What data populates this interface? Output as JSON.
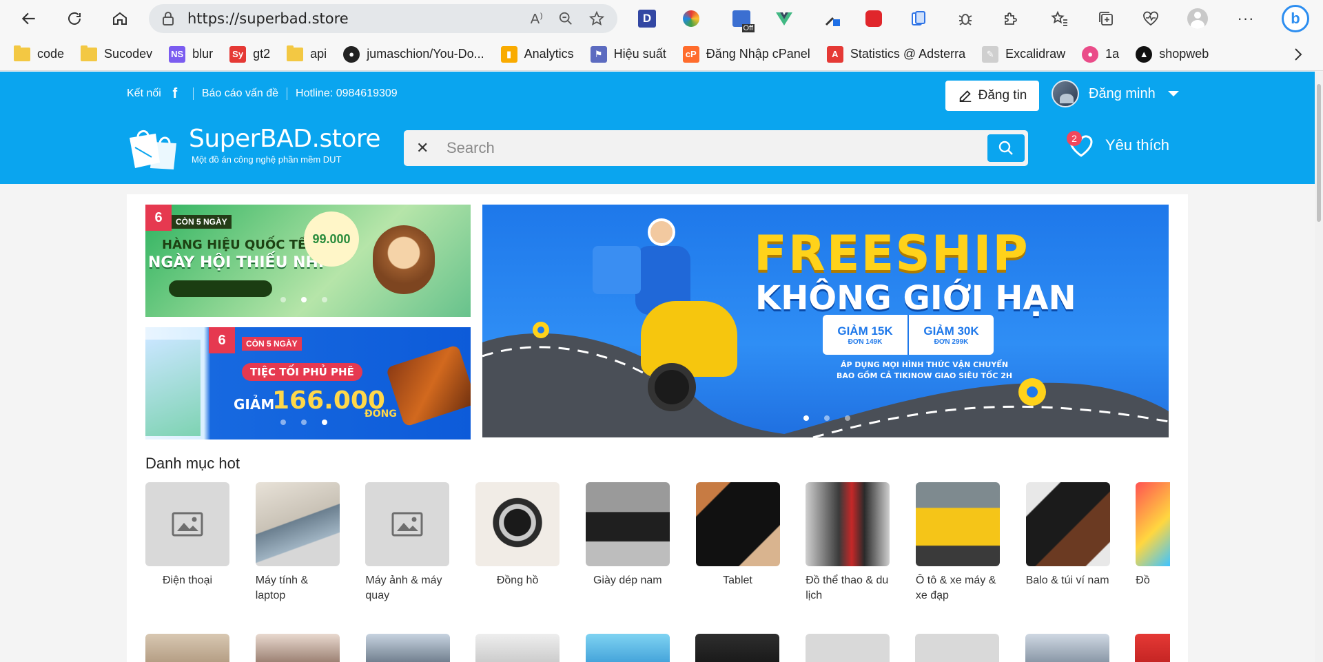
{
  "browser": {
    "url": "https://superbad.store",
    "bookmarks": [
      {
        "label": "code",
        "icon": "folder-icon"
      },
      {
        "label": "Sucodev",
        "icon": "folder-icon"
      },
      {
        "label": "blur",
        "icon": "blur-icon"
      },
      {
        "label": "gt2",
        "icon": "sy-icon"
      },
      {
        "label": "api",
        "icon": "folder-icon"
      },
      {
        "label": "jumaschion/You-Do...",
        "icon": "github-icon"
      },
      {
        "label": "Analytics",
        "icon": "analytics-icon"
      },
      {
        "label": "Hiệu suất",
        "icon": "performance-icon"
      },
      {
        "label": "Đăng Nhập cPanel",
        "icon": "cpanel-icon"
      },
      {
        "label": "Statistics @ Adsterra",
        "icon": "adsterra-icon"
      },
      {
        "label": "Excalidraw",
        "icon": "excalidraw-icon"
      },
      {
        "label": "1a",
        "icon": "dribbble-icon"
      },
      {
        "label": "shopweb",
        "icon": "shopweb-icon"
      }
    ]
  },
  "header": {
    "connect_label": "Kết nối",
    "report_label": "Báo cáo vấn đề",
    "hotline_label": "Hotline: 0984619309",
    "post_button": "Đăng tin",
    "user_name": "Đăng minh",
    "logo_title": "SuperBAD.store",
    "logo_subtitle": "Một đồ án công nghệ phần mềm DUT",
    "search_placeholder": "Search",
    "favorites_label": "Yêu thích",
    "favorites_count": "2"
  },
  "banners": {
    "b1_tag": "CÒN 5 NGÀY",
    "b1_line1": "HÀNG HIỆU QUỐC TẾ",
    "b1_line2": "NGÀY HỘI THIẾU NHI",
    "b1_price": "99.000",
    "b2_tag": "CÒN 5 NGÀY",
    "b2_line1": "TIỆC TỐI PHỦ PHÊ",
    "b2_line2": "GIẢM",
    "b2_price": "166.000",
    "b2_unit": "ĐỒNG",
    "b3_line1": "FREESHIP",
    "b3_line2": "KHÔNG GIỚI HẠN",
    "b3_offer1_big": "GIẢM 15K",
    "b3_offer1_small": "ĐƠN 149K",
    "b3_offer2_big": "GIẢM 30K",
    "b3_offer2_small": "ĐƠN 299K",
    "b3_note1": "ÁP DỤNG MỌI HÌNH THỨC VẬN CHUYỂN",
    "b3_note2": "BAO GỒM CẢ TIKINOW GIAO SIÊU TỐC 2H"
  },
  "categories": {
    "title": "Danh mục hot",
    "items": [
      {
        "label": "Điện thoại",
        "thumb": "placeholder"
      },
      {
        "label": "Máy tính & laptop",
        "thumb": "laptop"
      },
      {
        "label": "Máy ảnh & máy quay",
        "thumb": "placeholder"
      },
      {
        "label": "Đồng hồ",
        "thumb": "watch"
      },
      {
        "label": "Giày dép nam",
        "thumb": "sandals"
      },
      {
        "label": "Tablet",
        "thumb": "tablet"
      },
      {
        "label": "Đồ thể thao & du lịch",
        "thumb": "sports"
      },
      {
        "label": "Ô tô & xe máy & xe đạp",
        "thumb": "car"
      },
      {
        "label": "Balo & túi ví nam",
        "thumb": "wallet"
      },
      {
        "label": "Đồ",
        "thumb": "toys"
      }
    ]
  },
  "colors": {
    "brand": "#0aa5ef",
    "badge": "#f0475d"
  }
}
